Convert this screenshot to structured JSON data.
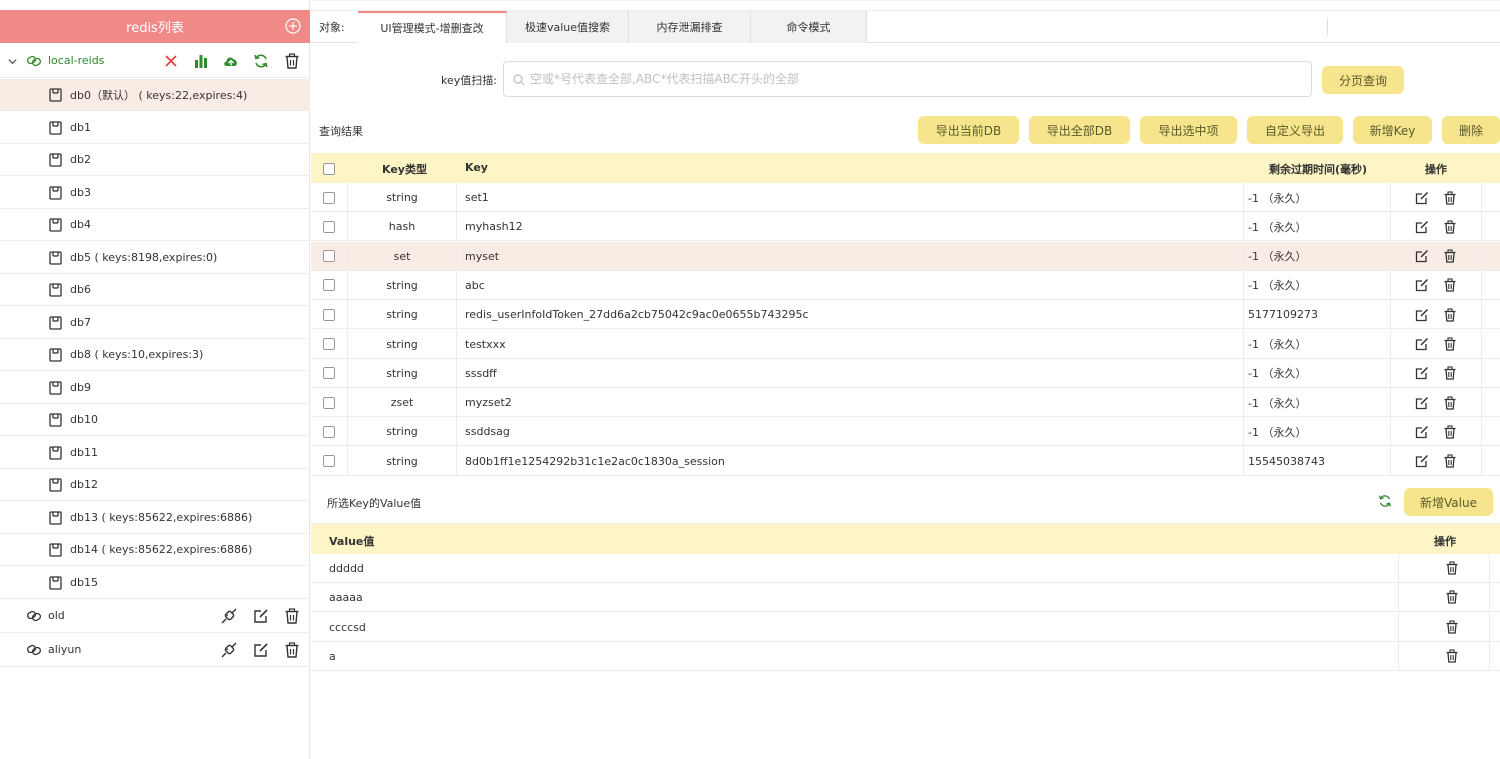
{
  "sidebar": {
    "title": "redis列表",
    "connections": [
      {
        "name": "local-reids"
      },
      {
        "name": "old"
      },
      {
        "name": "aliyun"
      }
    ],
    "dbs": [
      {
        "label": "db0（默认） ( keys:22,expires:4)"
      },
      {
        "label": "db1"
      },
      {
        "label": "db2"
      },
      {
        "label": "db3"
      },
      {
        "label": "db4"
      },
      {
        "label": "db5 ( keys:8198,expires:0)"
      },
      {
        "label": "db6"
      },
      {
        "label": "db7"
      },
      {
        "label": "db8 ( keys:10,expires:3)"
      },
      {
        "label": "db9"
      },
      {
        "label": "db10"
      },
      {
        "label": "db11"
      },
      {
        "label": "db12"
      },
      {
        "label": "db13 ( keys:85622,expires:6886)"
      },
      {
        "label": "db14 ( keys:85622,expires:6886)"
      },
      {
        "label": "db15"
      }
    ]
  },
  "tabs": {
    "object_label": "对象:",
    "items": [
      {
        "label": "UI管理模式-增删查改"
      },
      {
        "label": "极速value值搜索"
      },
      {
        "label": "内存泄漏排查"
      },
      {
        "label": "命令模式"
      }
    ]
  },
  "scan": {
    "label": "key值扫描:",
    "placeholder": "空或*号代表查全部,ABC*代表扫描ABC开头的全部",
    "value": "",
    "page_query": "分页查询"
  },
  "results": {
    "label": "查询结果",
    "buttons": {
      "export_current_db": "导出当前DB",
      "export_all_db": "导出全部DB",
      "export_selected": "导出选中项",
      "custom_export": "自定义导出",
      "add_key": "新增Key",
      "delete": "删除"
    },
    "columns": {
      "type": "Key类型",
      "key": "Key",
      "ttl": "剩余过期时间(毫秒)",
      "op": "操作"
    },
    "rows": [
      {
        "type": "string",
        "key": "set1",
        "ttl": "-1 （永久）"
      },
      {
        "type": "hash",
        "key": "myhash12",
        "ttl": "-1 （永久）"
      },
      {
        "type": "set",
        "key": "myset",
        "ttl": "-1 （永久）"
      },
      {
        "type": "string",
        "key": "abc",
        "ttl": "-1 （永久）"
      },
      {
        "type": "string",
        "key": "redis_userInfoIdToken_27dd6a2cb75042c9ac0e0655b743295c",
        "ttl": "5177109273"
      },
      {
        "type": "string",
        "key": "testxxx",
        "ttl": "-1 （永久）"
      },
      {
        "type": "string",
        "key": "sssdff",
        "ttl": "-1 （永久）"
      },
      {
        "type": "zset",
        "key": "myzset2",
        "ttl": "-1 （永久）"
      },
      {
        "type": "string",
        "key": "ssddsag",
        "ttl": "-1 （永久）"
      },
      {
        "type": "string",
        "key": "8d0b1ff1e1254292b31c1e2ac0c1830a_session",
        "ttl": "15545038743"
      }
    ]
  },
  "values": {
    "label": "所选Key的Value值",
    "add_value": "新增Value",
    "columns": {
      "value": "Value值",
      "op": "操作"
    },
    "rows": [
      {
        "value": "ddddd"
      },
      {
        "value": "aaaaa"
      },
      {
        "value": "ccccsd"
      },
      {
        "value": "a"
      }
    ]
  },
  "colors": {
    "accent_pink": "#f08a86",
    "button_yellow": "#f6e58d",
    "header_yellow": "#fdf5c5",
    "selected_row": "#f9ece5",
    "connection_green": "#2e8b2e",
    "close_red": "#e53935"
  }
}
